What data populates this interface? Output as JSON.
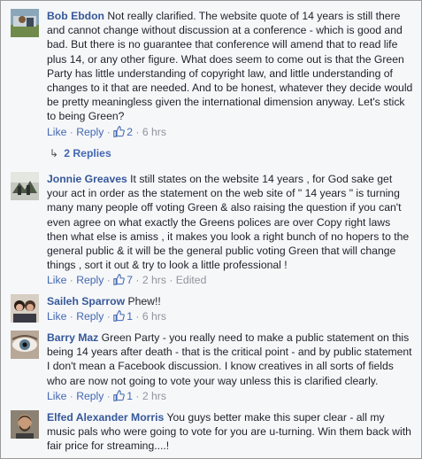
{
  "actions": {
    "like": "Like",
    "reply": "Reply",
    "sep": "·"
  },
  "comments": [
    {
      "author": "Bob Ebdon",
      "text": "Not really clarified. The website quote of 14 years is still there and cannot change without discussion at a conference - which is good and bad. But there is no guarantee that conference will amend that to read life plus 14, or any other figure. What does seem to come out is that the Green Party has little understanding of copyright law, and little understanding of changes to it that are needed. And to be honest, whatever they decide would be pretty meaningless given the international dimension anyway. Let's stick to being Green?",
      "likes": "2",
      "time": "6 hrs",
      "replies": "2 Replies",
      "avatar": "photo-avatar-icon"
    },
    {
      "author": "Jonnie Greaves",
      "text": "It still states on the website 14 years , for God sake get your act in order as the statement on the web site of \" 14 years \" is turning many many people off voting Green & also raising the question if you can't even agree on what exactly the Greens polices are over Copy right laws then what else is amiss , it makes you look a right bunch of no hopers to the general public & it will be the general public voting Green that will change things , sort it out & try to look a little professional !",
      "likes": "7",
      "time": "2 hrs",
      "edited": "Edited",
      "avatar": "photo-avatar-icon"
    },
    {
      "author": "Saileh Sparrow",
      "text": "Phew!!",
      "likes": "1",
      "time": "6 hrs",
      "avatar": "photo-avatar-icon"
    },
    {
      "author": "Barry Maz",
      "text": "Green Party - you really need to make a public statement on this being 14 years after death - that is the critical point - and by public statement I don't mean a Facebook discussion. I know creatives in all sorts of fields who are now not going to vote your way unless this is clarified clearly.",
      "likes": "1",
      "time": "2 hrs",
      "avatar": "eye-avatar-icon"
    },
    {
      "author": "Elfed Alexander Morris",
      "text": "You guys better make this super clear - all my music pals who were going to vote for you are u-turning. Win them back with fair price for streaming....!",
      "avatar": "portrait-avatar-icon"
    }
  ],
  "colors": {
    "link": "#4267b2",
    "author": "#365899",
    "muted": "#90949c",
    "background": "#f6f7f9"
  }
}
